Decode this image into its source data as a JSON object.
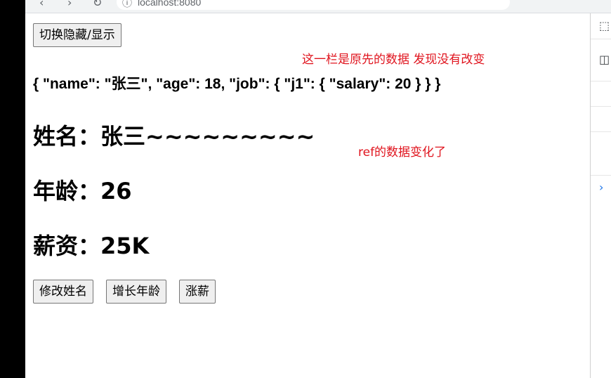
{
  "browser": {
    "url": "localhost:8080"
  },
  "toggle_button_label": "切换隐藏/显示",
  "original_json_text": "{ \"name\": \"张三\", \"age\": 18, \"job\": { \"j1\": { \"salary\": 20 } } }",
  "headings": {
    "name": "姓名：张三~~~~~~~~~",
    "age": "年龄：26",
    "salary": "薪资：25K"
  },
  "action_buttons": {
    "change_name": "修改姓名",
    "grow_age": "增长年龄",
    "raise_salary": "涨薪"
  },
  "annotations": {
    "original_unchanged": "这一栏是原先的数据 发现没有改变",
    "ref_changed": "ref的数据变化了"
  },
  "colors": {
    "annotation": "#e0141e",
    "left_strip": "#000000"
  }
}
